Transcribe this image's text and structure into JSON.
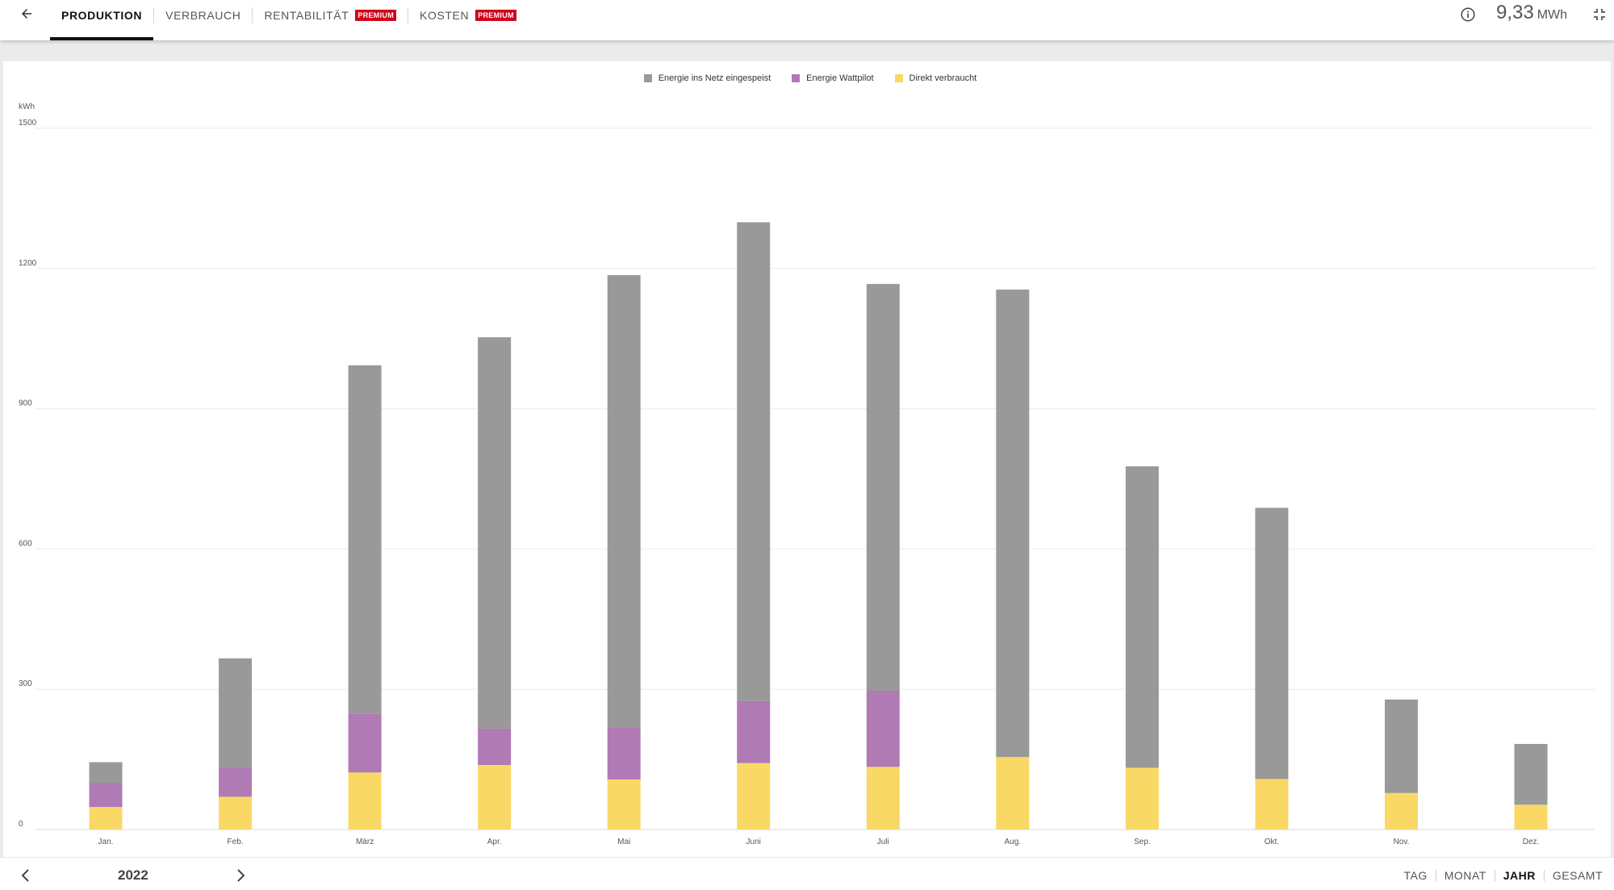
{
  "header": {
    "tabs": [
      {
        "label": "PRODUKTION",
        "active": true,
        "badge": ""
      },
      {
        "label": "VERBRAUCH",
        "active": false,
        "badge": ""
      },
      {
        "label": "RENTABILITÄT",
        "active": false,
        "badge": "PREMIUM"
      },
      {
        "label": "KOSTEN",
        "active": false,
        "badge": "PREMIUM"
      }
    ],
    "total_value": "9,33",
    "total_unit": "MWh",
    "icons": {
      "back": "arrow-left-icon",
      "info": "info-icon",
      "collapse": "collapse-icon"
    }
  },
  "colors": {
    "grid_feed": "#999999",
    "wattpilot": "#b07ab5",
    "direct": "#fad866",
    "premium_badge": "#d0021b"
  },
  "chart_data": {
    "type": "bar",
    "stacked": true,
    "ylabel": "kWh",
    "ylim": [
      0,
      1500
    ],
    "yticks": [
      0,
      300,
      600,
      900,
      1200,
      1500
    ],
    "grid": true,
    "legend_position": "top-center",
    "categories": [
      "Jan.",
      "Feb.",
      "März",
      "Apr.",
      "Mai",
      "Juni",
      "Juli",
      "Aug.",
      "Sep.",
      "Okt.",
      "Nov.",
      "Dez."
    ],
    "series": [
      {
        "name": "Direkt verbraucht",
        "color": "#fad866",
        "values": [
          48,
          70,
          122,
          138,
          107,
          142,
          134,
          155,
          132,
          108,
          78,
          53
        ]
      },
      {
        "name": "Energie Wattpilot",
        "color": "#b07ab5",
        "values": [
          52,
          63,
          126,
          78,
          112,
          133,
          163,
          0,
          0,
          0,
          0,
          0
        ]
      },
      {
        "name": "Energie ins Netz eingespeist",
        "color": "#999999",
        "values": [
          44,
          233,
          745,
          837,
          967,
          1024,
          870,
          1000,
          645,
          580,
          200,
          130
        ]
      }
    ]
  },
  "footer": {
    "year": "2022",
    "periods": [
      {
        "label": "TAG",
        "active": false
      },
      {
        "label": "MONAT",
        "active": false
      },
      {
        "label": "JAHR",
        "active": true
      },
      {
        "label": "GESAMT",
        "active": false
      }
    ],
    "icons": {
      "prev": "chevron-left-icon",
      "next": "chevron-right-icon"
    }
  }
}
